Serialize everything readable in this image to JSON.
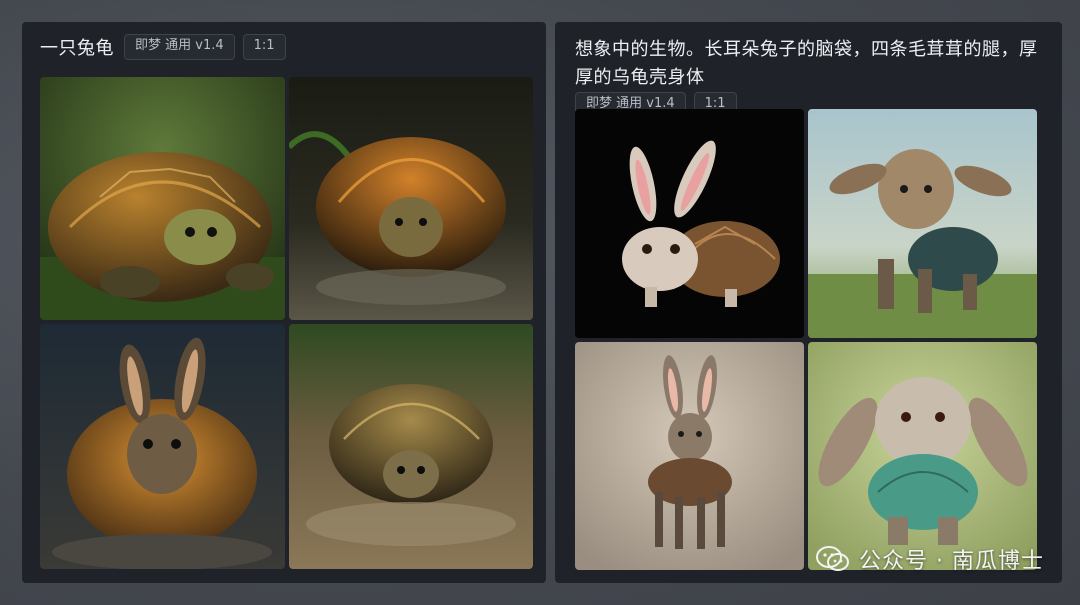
{
  "left_panel": {
    "prompt": "一只兔龟",
    "model_tag": "即梦 通用 v1.4",
    "ratio_tag": "1:1",
    "images": [
      {
        "desc": "tortoise-on-grass"
      },
      {
        "desc": "tortoise-dark-background"
      },
      {
        "desc": "rabbit-eared-tortoise"
      },
      {
        "desc": "tortoise-on-gravel"
      }
    ]
  },
  "right_panel": {
    "prompt": "想象中的生物。长耳朵兔子的脑袋，四条毛茸茸的腿，厚厚的乌龟壳身体",
    "model_tag": "即梦 通用 v1.4",
    "ratio_tag": "1:1",
    "images": [
      {
        "desc": "rabbit-with-turtle-shell-black-bg"
      },
      {
        "desc": "furry-creature-with-shell-meadow"
      },
      {
        "desc": "long-eared-shell-creature-beige-bg"
      },
      {
        "desc": "floppy-eared-rabbit-green-shell"
      }
    ]
  },
  "watermark": {
    "text": "公众号 · 南瓜博士",
    "icon": "wechat-icon"
  },
  "colors": {
    "card_bg": "#1f2229",
    "tag_border": "#3d424b",
    "page_bg": "#4a4e55"
  }
}
